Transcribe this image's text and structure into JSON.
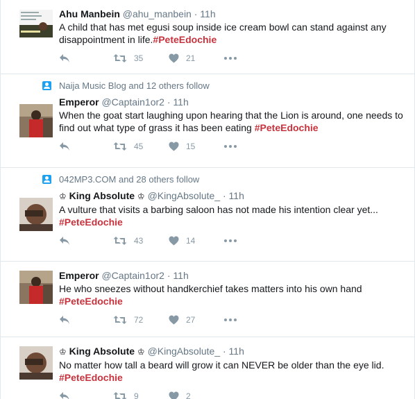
{
  "tweets": [
    {
      "name": "Ahu Manbein",
      "handle": "@ahu_manbein",
      "time": "11h",
      "dot": "·",
      "text": "A child that has met egusi soup inside ice cream bowl can stand against any disappointment in life.",
      "hashtag": "#PeteEdochie",
      "retweets": "35",
      "likes": "21"
    },
    {
      "context": "Naija Music Blog and 12 others follow",
      "name": "Emperor",
      "handle": "@Captain1or2",
      "time": "11h",
      "dot": "·",
      "text": "When the goat start laughing upon hearing that the Lion is around, one needs to find out what type of grass it has been eating ",
      "hashtag": "#PeteEdochie",
      "retweets": "45",
      "likes": "15"
    },
    {
      "context": "042MP3.COM and 28 others follow",
      "name": "King Absolute",
      "crown": "♔",
      "handle": "@KingAbsolute_",
      "time": "11h",
      "dot": "·",
      "text": "A vulture that visits a barbing saloon has not made his intention clear yet...",
      "hashtag": "#PeteEdochie",
      "retweets": "43",
      "likes": "14"
    },
    {
      "name": "Emperor",
      "handle": "@Captain1or2",
      "time": "11h",
      "dot": "·",
      "text": "He who sneezes without handkerchief takes matters into his own hand",
      "hashtag": "#PeteEdochie",
      "retweets": "72",
      "likes": "27"
    },
    {
      "name": "King Absolute",
      "crown": "♔",
      "handle": "@KingAbsolute_",
      "time": "11h",
      "dot": "·",
      "text": "No matter how tall a beard will grow it can NEVER be older than the eye lid.",
      "hashtag": "#PeteEdochie",
      "retweets": "9",
      "likes": "2"
    }
  ],
  "colors": {
    "hashtag": "#c8323c",
    "icon": "#8899a6",
    "context_icon": "#1da1f2"
  }
}
